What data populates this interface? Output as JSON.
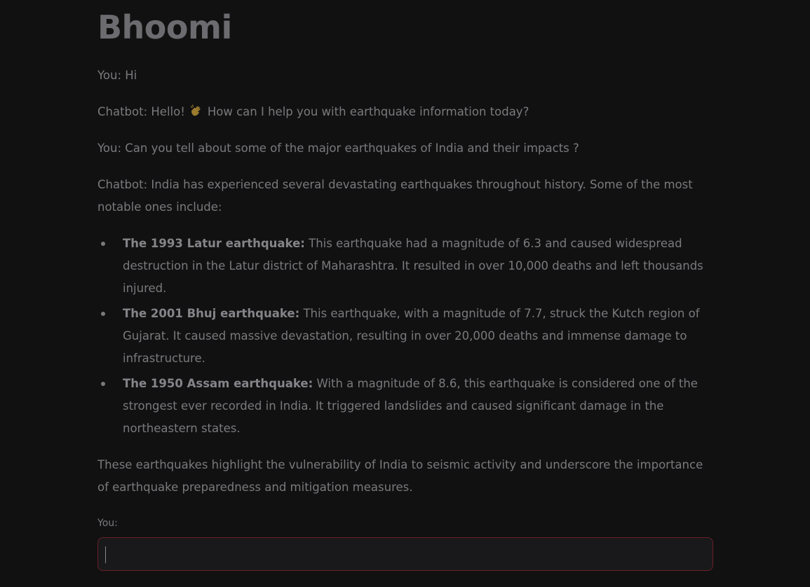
{
  "app": {
    "title": "Bhoomi"
  },
  "conversation": {
    "messages": [
      {
        "text": "You: Hi"
      },
      {
        "text_before_emoji": "Chatbot: Hello!",
        "emoji": "waving-hand-icon",
        "text_after_emoji": "How can I help you with earthquake information today?"
      },
      {
        "text": "You: Can you tell about some of the major earthquakes of India and their impacts ?"
      },
      {
        "text": "Chatbot: India has experienced several devastating earthquakes throughout history. Some of the most notable ones include:"
      }
    ],
    "earthquakes": [
      {
        "name": "The 1993 Latur earthquake:",
        "description": "This earthquake had a magnitude of 6.3 and caused widespread destruction in the Latur district of Maharashtra. It resulted in over 10,000 deaths and left thousands injured."
      },
      {
        "name": "The 2001 Bhuj earthquake:",
        "description": "This earthquake, with a magnitude of 7.7, struck the Kutch region of Gujarat. It caused massive devastation, resulting in over 20,000 deaths and immense damage to infrastructure."
      },
      {
        "name": "The 1950 Assam earthquake:",
        "description": "With a magnitude of 8.6, this earthquake is considered one of the strongest ever recorded in India. It triggered landslides and caused significant damage in the northeastern states."
      }
    ],
    "closing": "These earthquakes highlight the vulnerability of India to seismic activity and underscore the importance of earthquake preparedness and mitigation measures."
  },
  "input": {
    "label": "You:",
    "value": "",
    "placeholder": ""
  },
  "colors": {
    "background": "#111112",
    "text": "#7a7a7d",
    "input_border": "#6b1f27"
  }
}
